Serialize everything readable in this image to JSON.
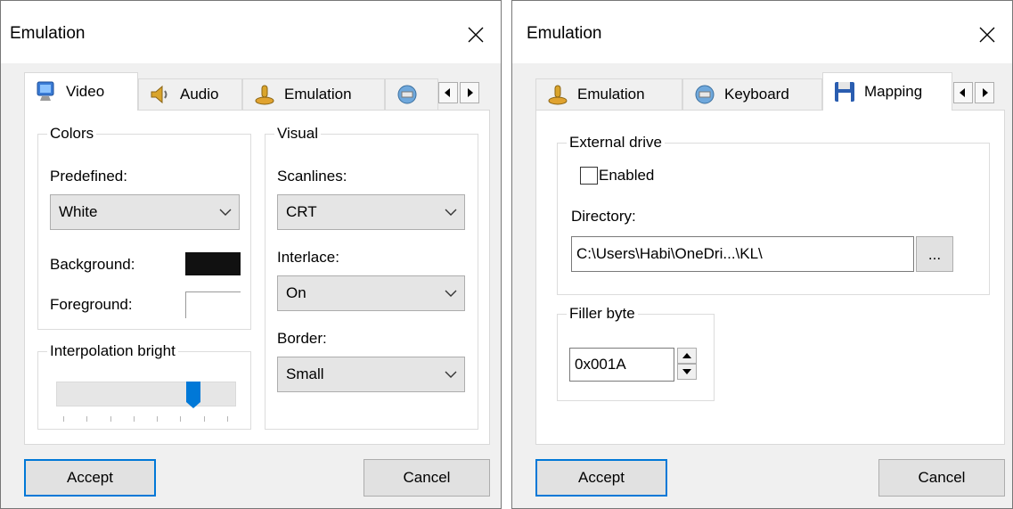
{
  "dialogs": [
    {
      "title": "Emulation",
      "tabs": [
        {
          "label": "Video",
          "icon": "monitor-icon"
        },
        {
          "label": "Audio",
          "icon": "speaker-icon"
        },
        {
          "label": "Emulation",
          "icon": "joystick-icon"
        },
        {
          "label": "",
          "icon": "keyboard-icon"
        }
      ],
      "colors": {
        "group_label": "Colors",
        "predefined_label": "Predefined:",
        "predefined_value": "White",
        "background_label": "Background:",
        "background_color": "#111111",
        "foreground_label": "Foreground:",
        "foreground_color": "#ffffff"
      },
      "interpolation": {
        "group_label": "Interpolation bright",
        "level": 0.8,
        "tick_count": 8
      },
      "visual": {
        "group_label": "Visual",
        "scanlines_label": "Scanlines:",
        "scanlines_value": "CRT",
        "interlace_label": "Interlace:",
        "interlace_value": "On",
        "border_label": "Border:",
        "border_value": "Small"
      },
      "buttons": {
        "accept": "Accept",
        "cancel": "Cancel"
      }
    },
    {
      "title": "Emulation",
      "tabs": [
        {
          "label": "Emulation",
          "icon": "joystick-icon"
        },
        {
          "label": "Keyboard",
          "icon": "keyboard-icon"
        },
        {
          "label": "Mapping",
          "icon": "floppy-disk-icon"
        }
      ],
      "external_drive": {
        "group_label": "External drive",
        "enabled_label": "Enabled",
        "enabled": false,
        "directory_label": "Directory:",
        "directory_value": "C:\\Users\\Habi\\OneDri...\\KL\\",
        "browse_label": "..."
      },
      "filler_byte": {
        "group_label": "Filler byte",
        "value": "0x001A"
      },
      "buttons": {
        "accept": "Accept",
        "cancel": "Cancel"
      }
    }
  ],
  "colors": {
    "accent": "#0078d7",
    "slider_thumb": "#0078d7"
  }
}
